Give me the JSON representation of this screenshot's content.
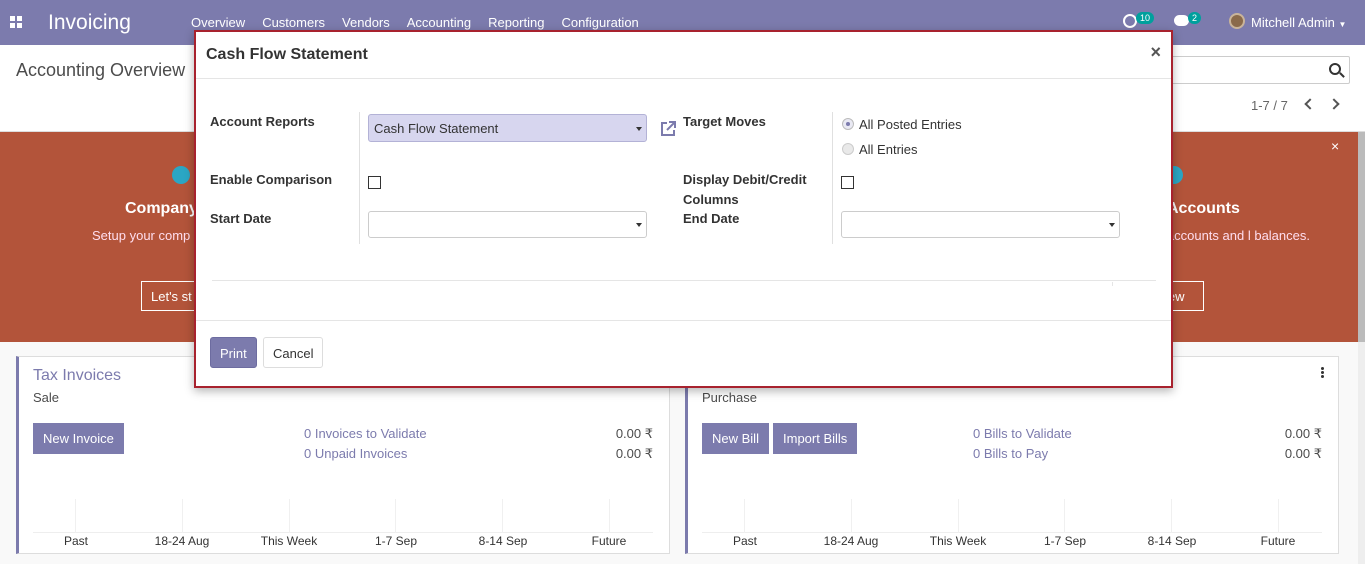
{
  "navbar": {
    "app_title": "Invoicing",
    "menu": [
      "Overview",
      "Customers",
      "Vendors",
      "Accounting",
      "Reporting",
      "Configuration"
    ],
    "activity_count": "10",
    "message_count": "2",
    "user_name": "Mitchell Admin"
  },
  "control_panel": {
    "title": "Accounting Overview",
    "pager": "1-7 / 7"
  },
  "banner": {
    "left_title": "Company",
    "left_text": "Setup your comp reports he",
    "left_button": "Let's st",
    "right_title": "Accounts",
    "right_text": "of accounts and l balances.",
    "right_button": "iew"
  },
  "cards": {
    "left": {
      "title": "Tax Invoices",
      "subtitle": "Sale",
      "button": "New Invoice",
      "link1": "0 Invoices to Validate",
      "amount1": "0.00 ₹",
      "link2": "0 Unpaid Invoices",
      "amount2": "0.00 ₹",
      "labels": [
        "Past",
        "18-24 Aug",
        "This Week",
        "1-7 Sep",
        "8-14 Sep",
        "Future"
      ]
    },
    "right": {
      "subtitle": "Purchase",
      "button1": "New Bill",
      "button2": "Import Bills",
      "link1": "0 Bills to Validate",
      "amount1": "0.00 ₹",
      "link2": "0 Bills to Pay",
      "amount2": "0.00 ₹",
      "labels": [
        "Past",
        "18-24 Aug",
        "This Week",
        "1-7 Sep",
        "8-14 Sep",
        "Future"
      ]
    }
  },
  "modal": {
    "title": "Cash Flow Statement",
    "close_symbol": "×",
    "account_reports_label": "Account Reports",
    "account_reports_value": "Cash Flow Statement",
    "target_moves_label": "Target Moves",
    "target_moves_options": [
      "All Posted Entries",
      "All Entries"
    ],
    "enable_comparison_label": "Enable Comparison",
    "display_debit_credit_label_1": "Display Debit/Credit",
    "display_debit_credit_label_2": "Columns",
    "start_date_label": "Start Date",
    "end_date_label": "End Date",
    "print_button": "Print",
    "cancel_button": "Cancel"
  }
}
